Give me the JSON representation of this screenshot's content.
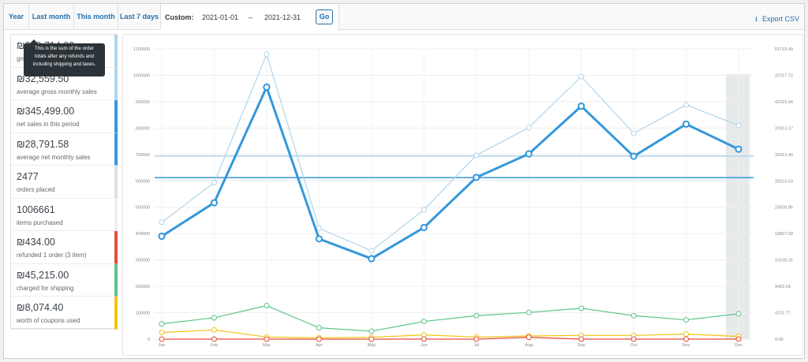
{
  "toolbar": {
    "tabs": [
      "Year",
      "Last month",
      "This month",
      "Last 7 days"
    ],
    "custom_label": "Custom:",
    "date_from": "2021-01-01",
    "date_separator": "–",
    "date_to": "2021-12-31",
    "go_label": "Go",
    "export_label": "Export CSV",
    "export_icon": "download-arrow-icon"
  },
  "legend": [
    {
      "value": "₪390,714.00",
      "desc": "gross sales in this period",
      "color": "#b1d4ea"
    },
    {
      "value": "₪32,559.50",
      "desc": "average gross monthly sales",
      "color": "#b1d4ea"
    },
    {
      "value": "₪345,499.00",
      "desc": "net sales in this period",
      "color": "#3498db"
    },
    {
      "value": "₪28,791.58",
      "desc": "average net monthly sales",
      "color": "#3498db"
    },
    {
      "value": "2477",
      "desc": "orders placed",
      "color": "#dbe1e3"
    },
    {
      "value": "1006661",
      "desc": "items purchased",
      "color": "#ecf0f1"
    },
    {
      "value": "₪434.00",
      "desc": "refunded 1 order (3 item)",
      "color": "#e74c3c"
    },
    {
      "value": "₪45,215.00",
      "desc": "charged for shipping",
      "color": "#5cc488"
    },
    {
      "value": "₪8,074.40",
      "desc": "worth of coupons used",
      "color": "#f1c40f"
    }
  ],
  "tooltip": {
    "lines": [
      "This is the sum of the order",
      "totals after any refunds and",
      "including shipping and taxes."
    ]
  },
  "chart_data": {
    "type": "line",
    "categories": [
      "Jan",
      "Feb",
      "Mar",
      "Apr",
      "May",
      "Jun",
      "Jul",
      "Aug",
      "Sep",
      "Oct",
      "Nov",
      "Dec"
    ],
    "left_axis": {
      "ylim": [
        0,
        1100000
      ],
      "ticks": [
        "0",
        "100000",
        "200000",
        "300000",
        "400000",
        "500000",
        "600000",
        "700000",
        "800000",
        "900000",
        "1000000",
        "1100000"
      ]
    },
    "right_axis": {
      "ticks": [
        "0.00",
        "4701.77",
        "9403.54",
        "14105.31",
        "18807.09",
        "23508.86",
        "28210.63",
        "32912.40",
        "37614.17",
        "42315.94",
        "47017.72",
        "51719.49"
      ]
    },
    "series": [
      {
        "key": "gross",
        "color": "#b1d4ea",
        "width": 1.2,
        "values": [
          443000,
          593000,
          1080000,
          420000,
          335000,
          490000,
          697000,
          802000,
          995000,
          780000,
          888000,
          810000
        ]
      },
      {
        "key": "net",
        "color": "#3498db",
        "width": 3,
        "values": [
          390000,
          517000,
          955000,
          380000,
          305000,
          423000,
          613000,
          702000,
          883000,
          693000,
          815000,
          720000
        ]
      },
      {
        "key": "shipping",
        "color": "#5cc488",
        "width": 1.2,
        "values": [
          58000,
          81000,
          127000,
          43000,
          30000,
          67000,
          89000,
          101000,
          117000,
          89000,
          73000,
          96000
        ]
      },
      {
        "key": "coupons",
        "color": "#f1c40f",
        "width": 1.2,
        "values": [
          25000,
          35000,
          8000,
          5000,
          7000,
          16000,
          8000,
          12000,
          14000,
          14000,
          19000,
          10000
        ]
      },
      {
        "key": "refunds",
        "color": "#e74c3c",
        "width": 1.2,
        "values": [
          0,
          0,
          0,
          0,
          0,
          0,
          0,
          7000,
          0,
          0,
          0,
          0
        ]
      }
    ],
    "avg_lines": [
      {
        "key": "avg-gross",
        "color": "#b1d4ea",
        "value": 694000
      },
      {
        "key": "avg-net",
        "color": "#3498db",
        "value": 612000
      }
    ],
    "highlight_category": "Dec",
    "grid": true
  }
}
